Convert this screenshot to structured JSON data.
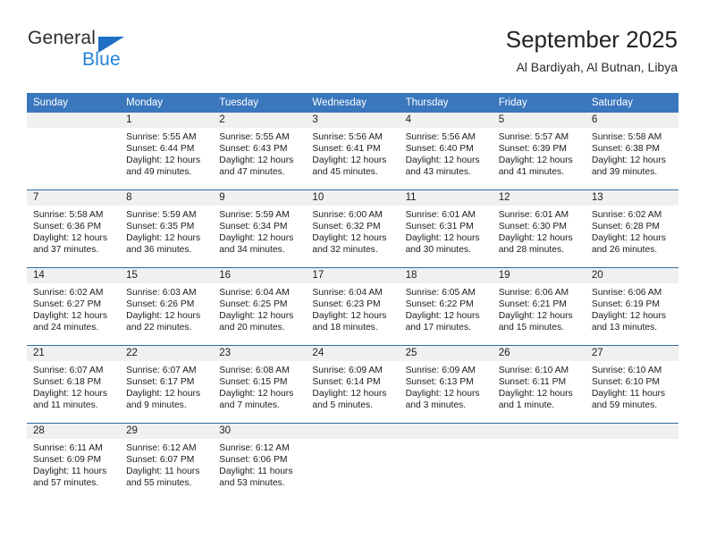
{
  "logo": {
    "line1": "General",
    "line2": "Blue",
    "triangle_icon": "blue-triangle-icon",
    "color_dark": "#2d2d2d",
    "color_blue": "#2483d6"
  },
  "header": {
    "title": "September 2025",
    "subtitle": "Al Bardiyah, Al Butnan, Libya"
  },
  "theme": {
    "header_bg": "#3a77bd",
    "header_text": "#ffffff",
    "row_divider": "#2e6da4",
    "daynum_band_bg": "#f0f0f0"
  },
  "calendar": {
    "weekday_headers": [
      "Sunday",
      "Monday",
      "Tuesday",
      "Wednesday",
      "Thursday",
      "Friday",
      "Saturday"
    ],
    "weeks": [
      [
        {
          "day": "",
          "sunrise": "",
          "sunset": "",
          "daylight_1": "",
          "daylight_2": ""
        },
        {
          "day": "1",
          "sunrise": "Sunrise: 5:55 AM",
          "sunset": "Sunset: 6:44 PM",
          "daylight_1": "Daylight: 12 hours",
          "daylight_2": "and 49 minutes."
        },
        {
          "day": "2",
          "sunrise": "Sunrise: 5:55 AM",
          "sunset": "Sunset: 6:43 PM",
          "daylight_1": "Daylight: 12 hours",
          "daylight_2": "and 47 minutes."
        },
        {
          "day": "3",
          "sunrise": "Sunrise: 5:56 AM",
          "sunset": "Sunset: 6:41 PM",
          "daylight_1": "Daylight: 12 hours",
          "daylight_2": "and 45 minutes."
        },
        {
          "day": "4",
          "sunrise": "Sunrise: 5:56 AM",
          "sunset": "Sunset: 6:40 PM",
          "daylight_1": "Daylight: 12 hours",
          "daylight_2": "and 43 minutes."
        },
        {
          "day": "5",
          "sunrise": "Sunrise: 5:57 AM",
          "sunset": "Sunset: 6:39 PM",
          "daylight_1": "Daylight: 12 hours",
          "daylight_2": "and 41 minutes."
        },
        {
          "day": "6",
          "sunrise": "Sunrise: 5:58 AM",
          "sunset": "Sunset: 6:38 PM",
          "daylight_1": "Daylight: 12 hours",
          "daylight_2": "and 39 minutes."
        }
      ],
      [
        {
          "day": "7",
          "sunrise": "Sunrise: 5:58 AM",
          "sunset": "Sunset: 6:36 PM",
          "daylight_1": "Daylight: 12 hours",
          "daylight_2": "and 37 minutes."
        },
        {
          "day": "8",
          "sunrise": "Sunrise: 5:59 AM",
          "sunset": "Sunset: 6:35 PM",
          "daylight_1": "Daylight: 12 hours",
          "daylight_2": "and 36 minutes."
        },
        {
          "day": "9",
          "sunrise": "Sunrise: 5:59 AM",
          "sunset": "Sunset: 6:34 PM",
          "daylight_1": "Daylight: 12 hours",
          "daylight_2": "and 34 minutes."
        },
        {
          "day": "10",
          "sunrise": "Sunrise: 6:00 AM",
          "sunset": "Sunset: 6:32 PM",
          "daylight_1": "Daylight: 12 hours",
          "daylight_2": "and 32 minutes."
        },
        {
          "day": "11",
          "sunrise": "Sunrise: 6:01 AM",
          "sunset": "Sunset: 6:31 PM",
          "daylight_1": "Daylight: 12 hours",
          "daylight_2": "and 30 minutes."
        },
        {
          "day": "12",
          "sunrise": "Sunrise: 6:01 AM",
          "sunset": "Sunset: 6:30 PM",
          "daylight_1": "Daylight: 12 hours",
          "daylight_2": "and 28 minutes."
        },
        {
          "day": "13",
          "sunrise": "Sunrise: 6:02 AM",
          "sunset": "Sunset: 6:28 PM",
          "daylight_1": "Daylight: 12 hours",
          "daylight_2": "and 26 minutes."
        }
      ],
      [
        {
          "day": "14",
          "sunrise": "Sunrise: 6:02 AM",
          "sunset": "Sunset: 6:27 PM",
          "daylight_1": "Daylight: 12 hours",
          "daylight_2": "and 24 minutes."
        },
        {
          "day": "15",
          "sunrise": "Sunrise: 6:03 AM",
          "sunset": "Sunset: 6:26 PM",
          "daylight_1": "Daylight: 12 hours",
          "daylight_2": "and 22 minutes."
        },
        {
          "day": "16",
          "sunrise": "Sunrise: 6:04 AM",
          "sunset": "Sunset: 6:25 PM",
          "daylight_1": "Daylight: 12 hours",
          "daylight_2": "and 20 minutes."
        },
        {
          "day": "17",
          "sunrise": "Sunrise: 6:04 AM",
          "sunset": "Sunset: 6:23 PM",
          "daylight_1": "Daylight: 12 hours",
          "daylight_2": "and 18 minutes."
        },
        {
          "day": "18",
          "sunrise": "Sunrise: 6:05 AM",
          "sunset": "Sunset: 6:22 PM",
          "daylight_1": "Daylight: 12 hours",
          "daylight_2": "and 17 minutes."
        },
        {
          "day": "19",
          "sunrise": "Sunrise: 6:06 AM",
          "sunset": "Sunset: 6:21 PM",
          "daylight_1": "Daylight: 12 hours",
          "daylight_2": "and 15 minutes."
        },
        {
          "day": "20",
          "sunrise": "Sunrise: 6:06 AM",
          "sunset": "Sunset: 6:19 PM",
          "daylight_1": "Daylight: 12 hours",
          "daylight_2": "and 13 minutes."
        }
      ],
      [
        {
          "day": "21",
          "sunrise": "Sunrise: 6:07 AM",
          "sunset": "Sunset: 6:18 PM",
          "daylight_1": "Daylight: 12 hours",
          "daylight_2": "and 11 minutes."
        },
        {
          "day": "22",
          "sunrise": "Sunrise: 6:07 AM",
          "sunset": "Sunset: 6:17 PM",
          "daylight_1": "Daylight: 12 hours",
          "daylight_2": "and 9 minutes."
        },
        {
          "day": "23",
          "sunrise": "Sunrise: 6:08 AM",
          "sunset": "Sunset: 6:15 PM",
          "daylight_1": "Daylight: 12 hours",
          "daylight_2": "and 7 minutes."
        },
        {
          "day": "24",
          "sunrise": "Sunrise: 6:09 AM",
          "sunset": "Sunset: 6:14 PM",
          "daylight_1": "Daylight: 12 hours",
          "daylight_2": "and 5 minutes."
        },
        {
          "day": "25",
          "sunrise": "Sunrise: 6:09 AM",
          "sunset": "Sunset: 6:13 PM",
          "daylight_1": "Daylight: 12 hours",
          "daylight_2": "and 3 minutes."
        },
        {
          "day": "26",
          "sunrise": "Sunrise: 6:10 AM",
          "sunset": "Sunset: 6:11 PM",
          "daylight_1": "Daylight: 12 hours",
          "daylight_2": "and 1 minute."
        },
        {
          "day": "27",
          "sunrise": "Sunrise: 6:10 AM",
          "sunset": "Sunset: 6:10 PM",
          "daylight_1": "Daylight: 11 hours",
          "daylight_2": "and 59 minutes."
        }
      ],
      [
        {
          "day": "28",
          "sunrise": "Sunrise: 6:11 AM",
          "sunset": "Sunset: 6:09 PM",
          "daylight_1": "Daylight: 11 hours",
          "daylight_2": "and 57 minutes."
        },
        {
          "day": "29",
          "sunrise": "Sunrise: 6:12 AM",
          "sunset": "Sunset: 6:07 PM",
          "daylight_1": "Daylight: 11 hours",
          "daylight_2": "and 55 minutes."
        },
        {
          "day": "30",
          "sunrise": "Sunrise: 6:12 AM",
          "sunset": "Sunset: 6:06 PM",
          "daylight_1": "Daylight: 11 hours",
          "daylight_2": "and 53 minutes."
        },
        {
          "day": "",
          "sunrise": "",
          "sunset": "",
          "daylight_1": "",
          "daylight_2": ""
        },
        {
          "day": "",
          "sunrise": "",
          "sunset": "",
          "daylight_1": "",
          "daylight_2": ""
        },
        {
          "day": "",
          "sunrise": "",
          "sunset": "",
          "daylight_1": "",
          "daylight_2": ""
        },
        {
          "day": "",
          "sunrise": "",
          "sunset": "",
          "daylight_1": "",
          "daylight_2": ""
        }
      ]
    ]
  }
}
